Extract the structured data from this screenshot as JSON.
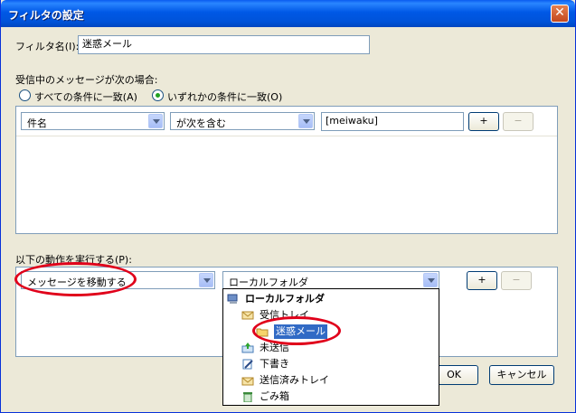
{
  "window": {
    "title": "フィルタの設定",
    "close": "✕"
  },
  "filter_name": {
    "label": "フィルタ名(I):",
    "value": "迷惑メール"
  },
  "match": {
    "label": "受信中のメッセージが次の場合:",
    "all_option": "すべての条件に一致(A)",
    "any_option": "いずれかの条件に一致(O)"
  },
  "rule": {
    "field": "件名",
    "operator": "が次を含む",
    "value": "[meiwaku]",
    "add": "+",
    "remove": "−"
  },
  "actions": {
    "label": "以下の動作を実行する(P):",
    "action": "メッセージを移動する",
    "target": "ローカルフォルダ",
    "add": "+",
    "remove": "−"
  },
  "folders": [
    {
      "name": "ローカルフォルダ",
      "icon": "computer-icon"
    },
    {
      "name": "受信トレイ",
      "icon": "inbox-icon"
    },
    {
      "name": "迷惑メール",
      "icon": "folder-icon"
    },
    {
      "name": "未送信",
      "icon": "outbox-icon"
    },
    {
      "name": "下書き",
      "icon": "drafts-icon"
    },
    {
      "name": "送信済みトレイ",
      "icon": "sent-icon"
    },
    {
      "name": "ごみ箱",
      "icon": "trash-icon"
    }
  ],
  "buttons": {
    "ok": "OK",
    "cancel": "キャンセル"
  },
  "colors": {
    "highlight": "#316ac5",
    "annotation": "#e0001a",
    "titlebar": "#0058e6"
  }
}
